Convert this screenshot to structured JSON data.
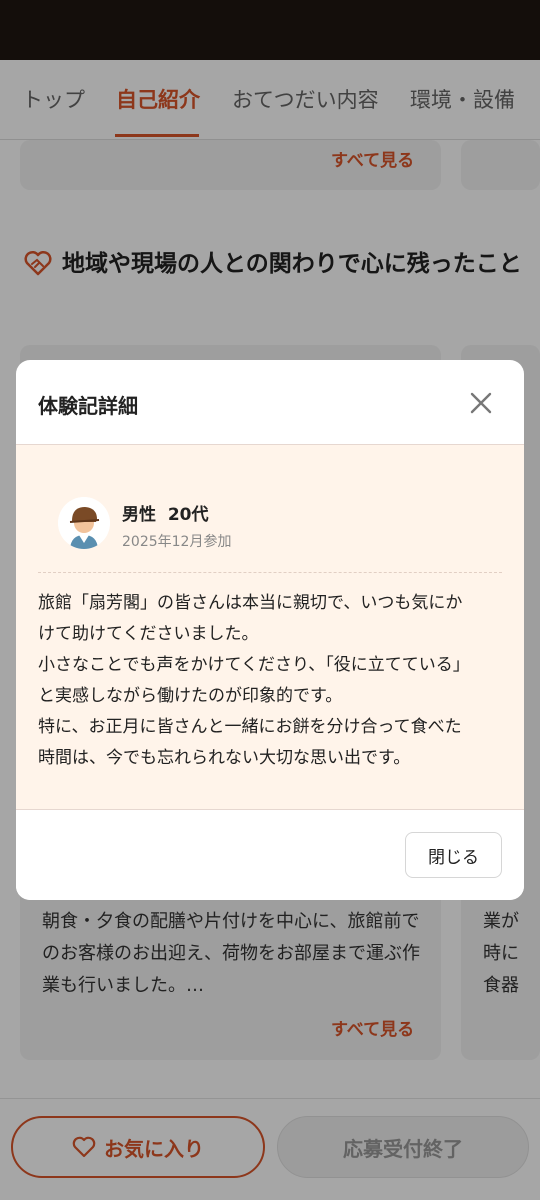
{
  "tabs": [
    {
      "label": "トップ",
      "active": false
    },
    {
      "label": "自己紹介",
      "active": true
    },
    {
      "label": "おてつだい内容",
      "active": false
    },
    {
      "label": "環境・設備",
      "active": false
    }
  ],
  "cards_top": {
    "see_all": "すべて見る"
  },
  "section": {
    "icon": "heart-handshake-icon",
    "title": "地域や現場の人との関わりで心に残ったこと"
  },
  "card_bottom": {
    "text": "朝食・夕食の配膳や片付けを中心に、旅館前でのお客様のお出迎え、荷物をお部屋まで運ぶ作業も行いました。…",
    "see_all": "すべて見る",
    "right_text_lines": [
      "業が",
      "時に",
      "食器"
    ]
  },
  "bottom_bar": {
    "favorite_label": "お気に入り",
    "favorite_icon": "heart-outline-icon",
    "apply_label": "応募受付終了"
  },
  "modal": {
    "title": "体験記詳細",
    "close_icon": "close-icon",
    "user": {
      "avatar": "avatar-icon",
      "gender_age": "男性  20代",
      "joined": "2025年12月参加"
    },
    "story_lines": [
      "旅館「扇芳閣」の皆さんは本当に親切で、いつも気にか",
      "けて助けてくださいました。",
      "小さなことでも声をかけてくださり、「役に立てている」",
      "と実感しながら働けたのが印象的です。",
      "特に、お正月に皆さんと一緒にお餅を分け合って食べた",
      "時間は、今でも忘れられない大切な思い出です。"
    ],
    "close_button": "閉じる"
  },
  "colors": {
    "accent": "#d9552a",
    "modal_body_bg": "#fff4ea",
    "status_bar": "#140e0b"
  }
}
